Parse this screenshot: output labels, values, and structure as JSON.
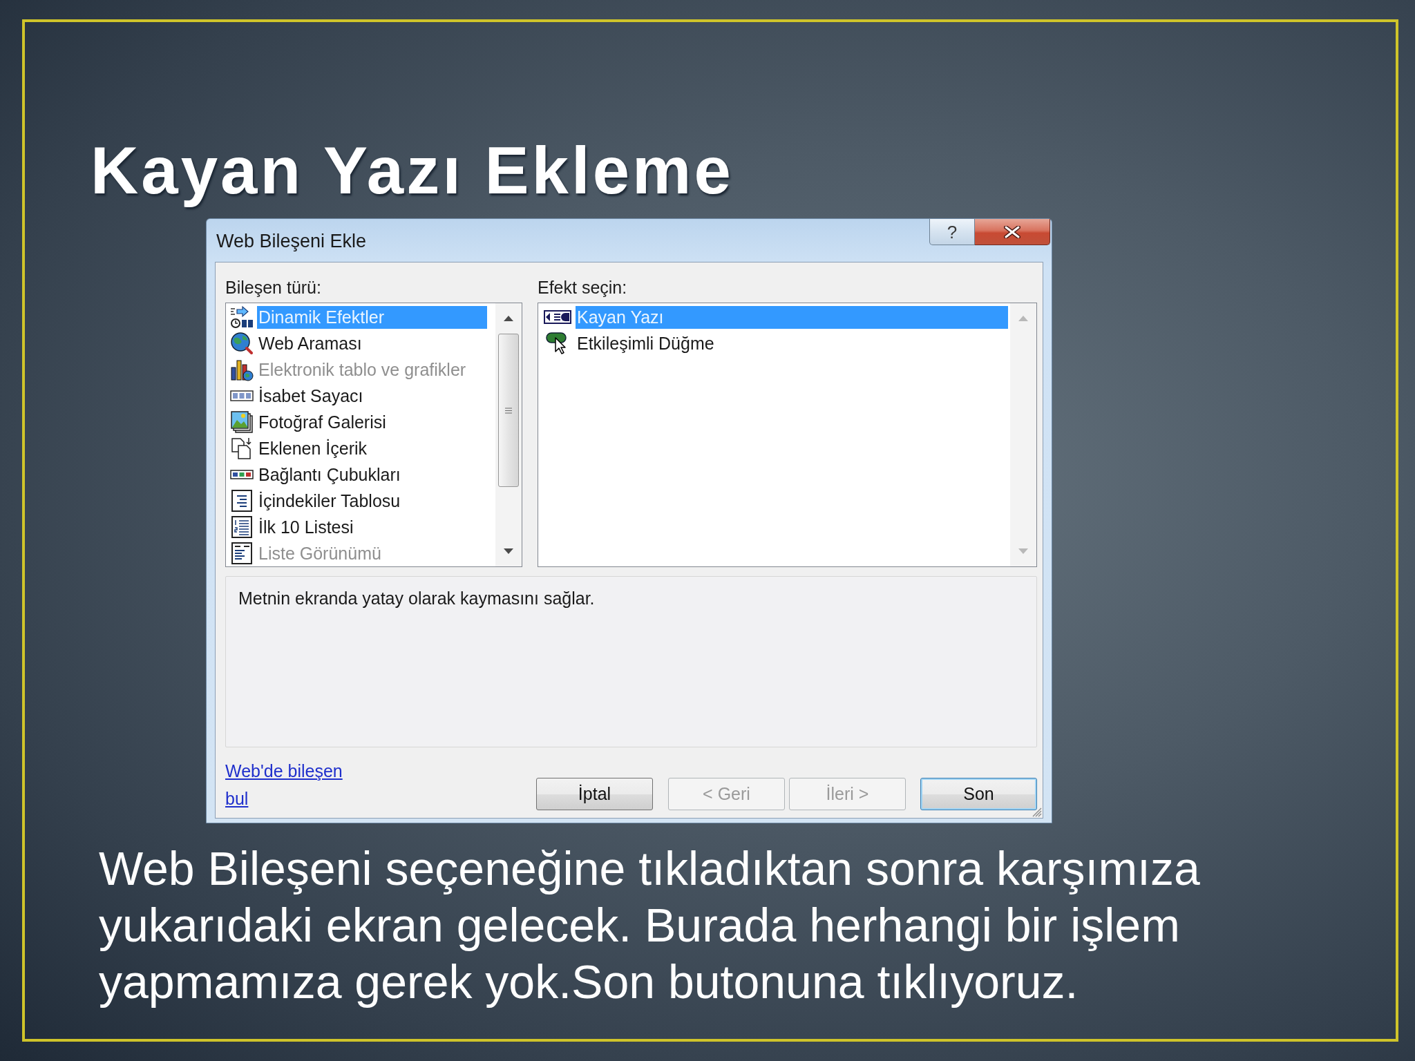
{
  "slide_title": "Kayan Yazı Ekleme",
  "dialog": {
    "title": "Web Bileşeni Ekle",
    "help_button": "?",
    "component_list": {
      "label": "Bileşen türü:",
      "items": [
        {
          "label": "Dinamik Efektler",
          "selected": true,
          "disabled": false
        },
        {
          "label": "Web Araması",
          "selected": false,
          "disabled": false
        },
        {
          "label": "Elektronik tablo ve grafikler",
          "selected": false,
          "disabled": true
        },
        {
          "label": "İsabet Sayacı",
          "selected": false,
          "disabled": false
        },
        {
          "label": "Fotoğraf Galerisi",
          "selected": false,
          "disabled": false
        },
        {
          "label": "Eklenen İçerik",
          "selected": false,
          "disabled": false
        },
        {
          "label": "Bağlantı Çubukları",
          "selected": false,
          "disabled": false
        },
        {
          "label": "İçindekiler Tablosu",
          "selected": false,
          "disabled": false
        },
        {
          "label": "İlk 10 Listesi",
          "selected": false,
          "disabled": false
        },
        {
          "label": "Liste Görünümü",
          "selected": false,
          "disabled": true
        }
      ]
    },
    "effect_list": {
      "label": "Efekt seçin:",
      "items": [
        {
          "label": "Kayan Yazı",
          "selected": true,
          "disabled": false
        },
        {
          "label": "Etkileşimli Düğme",
          "selected": false,
          "disabled": false
        }
      ]
    },
    "description": "Metnin ekranda yatay olarak kaymasını sağlar.",
    "link": "Web'de bileşen bul",
    "buttons": [
      {
        "label": "İptal",
        "disabled": false,
        "default": false
      },
      {
        "label": "< Geri",
        "disabled": true,
        "default": false
      },
      {
        "label": "İleri >",
        "disabled": true,
        "default": false
      },
      {
        "label": "Son",
        "disabled": false,
        "default": true
      }
    ]
  },
  "caption": "Web Bileşeni seçeneğine tıkladıktan sonra karşımıza yukarıdaki ekran gelecek. Burada herhangi bir işlem yapmamıza gerek yok.Son butonuna tıklıyoruz."
}
